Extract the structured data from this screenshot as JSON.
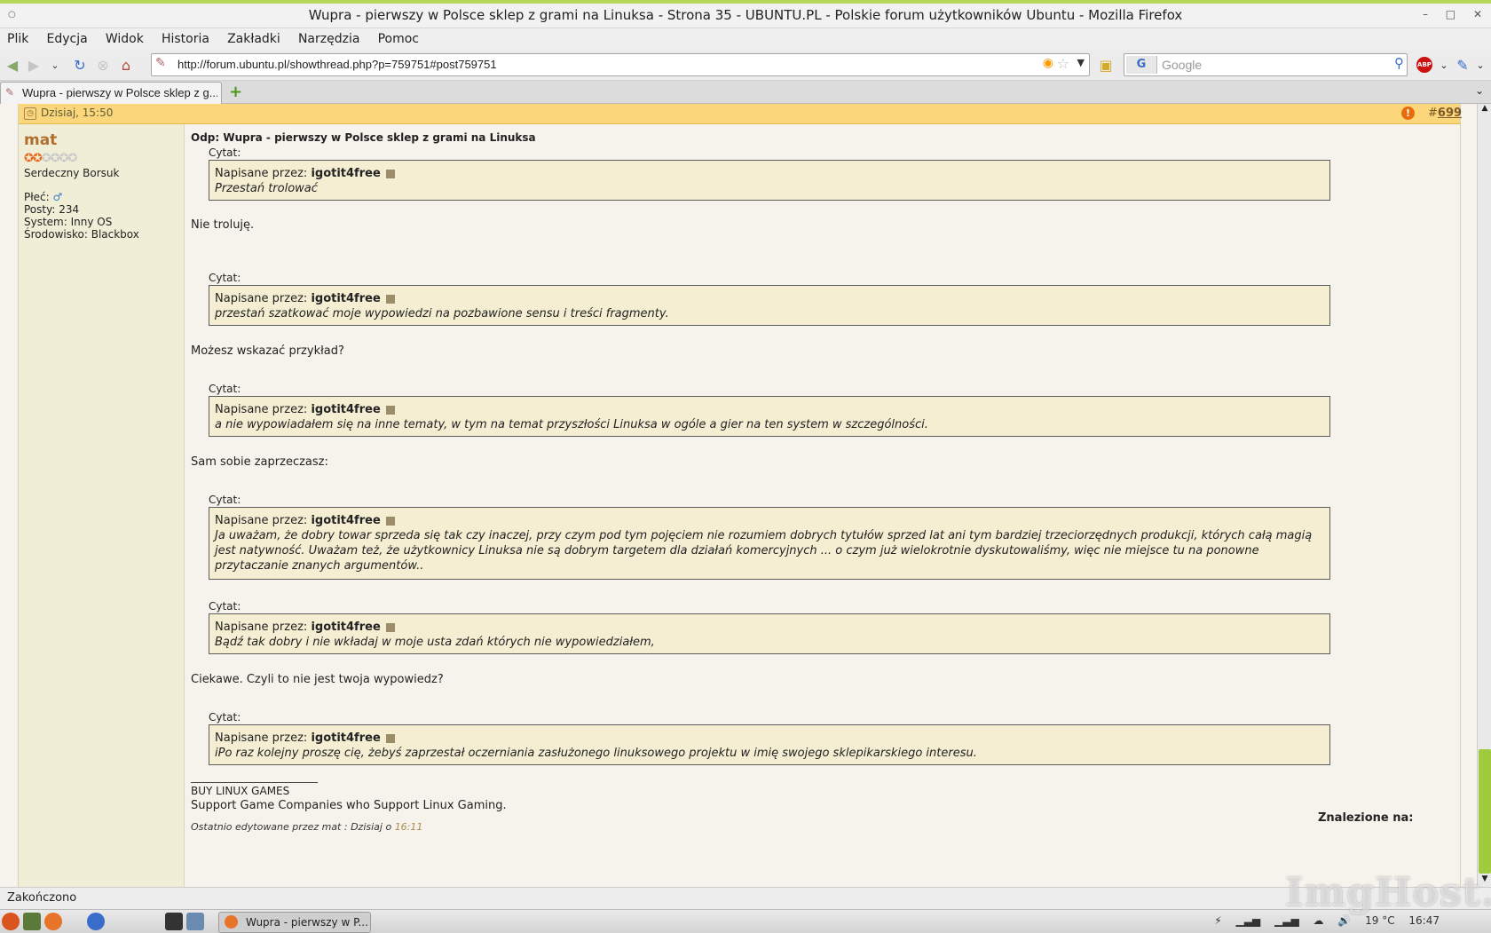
{
  "window": {
    "title": "Wupra - pierwszy w Polsce sklep z grami na Linuksa - Strona 35 - UBUNTU.PL - Polskie forum użytkowników Ubuntu - Mozilla Firefox"
  },
  "menu": [
    "Plik",
    "Edycja",
    "Widok",
    "Historia",
    "Zakładki",
    "Narzędzia",
    "Pomoc"
  ],
  "toolbar": {
    "url": "http://forum.ubuntu.pl/showthread.php?p=759751#post759751",
    "search_placeholder": "Google",
    "search_engine": "G",
    "abp": "ABP"
  },
  "tab": {
    "label": "Wupra - pierwszy w Polsce sklep z g...",
    "new_tab": "+"
  },
  "post": {
    "date": "Dzisiaj, 15:50",
    "number": "699",
    "number_prefix": "#",
    "title": "Odp: Wupra - pierwszy w Polsce sklep z grami na Linuksa",
    "author": {
      "name": "mat",
      "rank": "Serdeczny Borsuk",
      "gender_label": "Płeć:",
      "gender_symbol": "♂",
      "posts": "Posty: 234",
      "system": "System: Inny OS",
      "environment": "Środowisko: Blackbox"
    },
    "quote_label": "Cytat:",
    "quote_prefix": "Napisane przez:",
    "quotes": [
      {
        "author": "igotit4free",
        "text": "Przestań trolować"
      },
      {
        "author": "igotit4free",
        "text": "przestań szatkować moje wypowiedzi na pozbawione sensu i treści fragmenty."
      },
      {
        "author": "igotit4free",
        "text": "a nie wypowiadałem się na inne tematy, w tym na temat przyszłości Linuksa w ogóle a gier na ten system w szczególności."
      },
      {
        "author": "igotit4free",
        "text": "Ja uważam, że dobry towar sprzeda się tak czy inaczej, przy czym pod tym pojęciem nie rozumiem dobrych tytułów sprzed lat ani tym bardziej trzeciorzędnych produkcji, których całą magią jest natywność. Uważam też, że użytkownicy Linuksa nie są dobrym targetem dla działań komercyjnych ... o czym już wielokrotnie dyskutowaliśmy, więc nie miejsce tu na ponowne przytaczanie znanych argumentów.."
      },
      {
        "author": "igotit4free",
        "text": "Bądź tak dobry i nie wkładaj w moje usta zdań których nie wypowiedziałem,"
      },
      {
        "author": "igotit4free",
        "text": "iPo raz kolejny proszę cię, żebyś zaprzestał oczerniania zasłużonego linuksowego projektu w imię swojego sklepikarskiego interesu."
      }
    ],
    "replies": [
      "Nie troluję.",
      "Możesz wskazać przykład?",
      "Sam sobie zaprzeczasz:",
      "Ciekawe. Czyli to nie jest twoja wypowiedz?"
    ],
    "signature": {
      "line1": "BUY LINUX GAMES",
      "line2": "Support Game Companies who Support Linux Gaming."
    },
    "edited": {
      "prefix": "Ostatnio edytowane przez mat : Dzisiaj o",
      "time": "16:11"
    },
    "found_on": "Znalezione na:"
  },
  "status": {
    "text": "Zakończono"
  },
  "taskbar": {
    "task_label": "Wupra - pierwszy w P...",
    "temperature": "19 °C",
    "clock": "16:47"
  },
  "watermark": "ImgHost.pl",
  "colors": {
    "header": "#fbd67a",
    "quote_bg": "#f5eed3",
    "sidebar_bg": "#f1eed8",
    "username": "#b06f2e",
    "scroll_thumb": "#9fcb3f"
  }
}
